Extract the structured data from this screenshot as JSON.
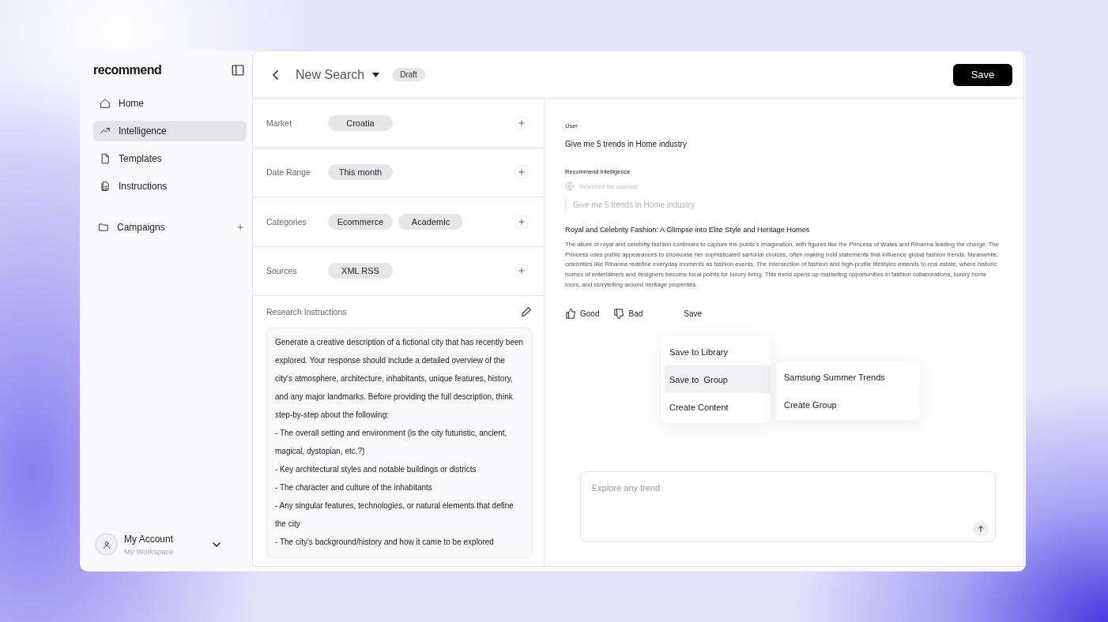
{
  "sidebar": {
    "logo": "recommend",
    "nav": [
      {
        "kind": "home",
        "label": "Home",
        "selected": false
      },
      {
        "kind": "trend",
        "label": "Intelligence",
        "selected": true
      },
      {
        "kind": "file",
        "label": "Templates",
        "selected": false
      },
      {
        "kind": "docs",
        "label": "Instructions",
        "selected": false
      }
    ],
    "campaigns": {
      "label": "Campaigns"
    },
    "account": {
      "name": "My Account",
      "workspace": "My Workspace"
    }
  },
  "header": {
    "title": "New Search",
    "status": "Draft",
    "save": "Save"
  },
  "filters": [
    {
      "label": "Market",
      "chips": [
        "Croatia"
      ]
    },
    {
      "label": "Date Range",
      "chips": [
        "This month"
      ]
    },
    {
      "label": "Categories",
      "chips": [
        "Ecommerce",
        "Academic"
      ]
    },
    {
      "label": "Sources",
      "chips": [
        "XML RSS"
      ]
    }
  ],
  "instructions": {
    "title": "Research Instructions",
    "lines": [
      "Generate a creative description of a fictional city that has recently been explored. Your response should include a detailed overview of the city's atmosphere, architecture, inhabitants, unique features, history, and any major landmarks. Before providing the full description, think step-by-step about the following:",
      "- The overall setting and environment (is the city futuristic, ancient, magical, dystopian, etc.?)",
      "- Key architectural styles and notable buildings or districts",
      "- The character and culture of the inhabitants",
      "- Any singular features, technologies, or natural elements that define the city",
      "- The city's background/history and how it came to be explored"
    ]
  },
  "chat": {
    "user_label": "User",
    "user_message": "Give me 5 trends in Home industry",
    "assistant_label": "Recommend Intelligence",
    "status": "Searched the sources",
    "query": "Give me 5 trends in Home industry",
    "answer_title": "Royal and Celebrity Fashion: A Glimpse into Elite Style and Heritage Homes",
    "answer_body": "The allure of royal and celebrity fashion continues to capture the public's imagination, with figures like the Princess of Wales and Rihanna leading the charge. The Princess uses public appearances to showcase her sophisticated sartorial choices, often making bold statements that influence global fashion trends. Meanwhile, celebrities like Rihanna redefine everyday moments as fashion events. The intersection of fashion and high-profile lifestyles extends to real estate, where historic homes of entertainers and designers become focal points for luxury living. This trend opens up marketing opportunities in fashion collaborations, luxury home tours, and storytelling around heritage properties.",
    "feedback": [
      {
        "kind": "up",
        "label": "Good"
      },
      {
        "kind": "down",
        "label": "Bad"
      }
    ],
    "save": "Save",
    "menu": [
      {
        "label": "Save to Library",
        "selected": false
      },
      {
        "label": "Save to  Group",
        "selected": true
      },
      {
        "label": "Create Content",
        "selected": false
      }
    ],
    "submenu": [
      "Samsung Summer Trends",
      "Create Group"
    ],
    "composer": {
      "placeholder": "Explore any trend"
    }
  }
}
